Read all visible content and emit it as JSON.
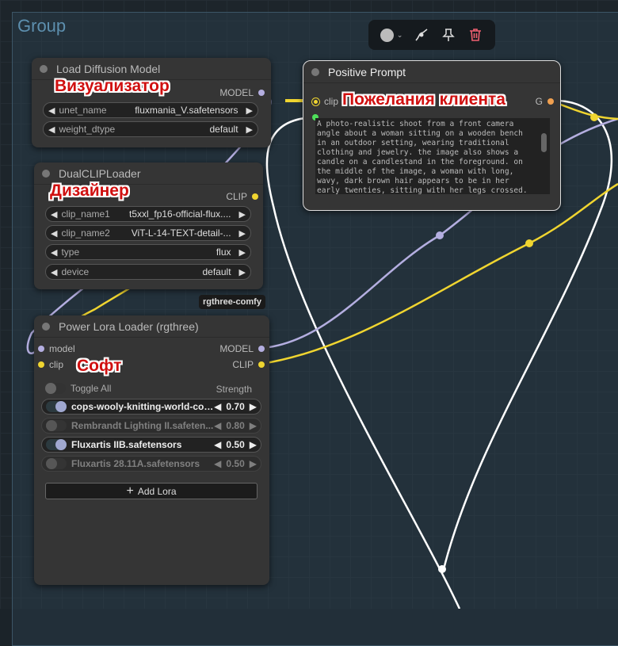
{
  "group": {
    "title": "Group"
  },
  "toolbar": {
    "color_icon": "color-circle",
    "items": [
      "color-picker",
      "bypass-icon",
      "pin-icon",
      "trash-icon"
    ]
  },
  "nodes": {
    "load_diffusion": {
      "title": "Load Diffusion Model",
      "overlay": "Визуализатор",
      "output": "MODEL",
      "widgets": [
        {
          "label": "unet_name",
          "value": "fluxmania_V.safetensors"
        },
        {
          "label": "weight_dtype",
          "value": "default"
        }
      ]
    },
    "dual_clip": {
      "title": "DualCLIPLoader",
      "overlay": "Дизайнер",
      "output": "CLIP",
      "badge": "rgthree-comfy",
      "widgets": [
        {
          "label": "clip_name1",
          "value": "t5xxl_fp16-official-flux...."
        },
        {
          "label": "clip_name2",
          "value": "ViT-L-14-TEXT-detail-..."
        },
        {
          "label": "type",
          "value": "flux"
        },
        {
          "label": "device",
          "value": "default"
        }
      ]
    },
    "power_lora": {
      "title": "Power Lora Loader (rgthree)",
      "overlay": "Софт",
      "inputs": [
        "model",
        "clip"
      ],
      "outputs": [
        "MODEL",
        "CLIP"
      ],
      "toggle_all": "Toggle All",
      "strength_label": "Strength",
      "loras": [
        {
          "name": "cops-wooly-knitting-world-conf...",
          "strength": "0.70",
          "enabled": true
        },
        {
          "name": "Rembrandt Lighting II.safeten...",
          "strength": "0.80",
          "enabled": false
        },
        {
          "name": "Fluxartis IIB.safetensors",
          "strength": "0.50",
          "enabled": true
        },
        {
          "name": "Fluxartis 28.11A.safetensors",
          "strength": "0.50",
          "enabled": false
        }
      ],
      "add_lora": "Add Lora"
    },
    "positive_prompt": {
      "title": "Positive Prompt",
      "overlay": "Пожелания клиента",
      "input": "clip",
      "output_partial": "G",
      "text": "A photo-realistic shoot from a front camera angle about a woman sitting on a wooden bench in an outdoor setting, wearing traditional clothing and jewelry. the image also shows a candle on a candlestand in the foreground. on the middle of the image, a woman with long, wavy, dark brown hair appears to be in her early twenties, sitting with her legs crossed. she is wearing a maroon"
    }
  },
  "colors": {
    "model": "#b4aee0",
    "clip": "#f0d530",
    "conditioning": "#f0a050",
    "link_white": "#ffffff"
  }
}
